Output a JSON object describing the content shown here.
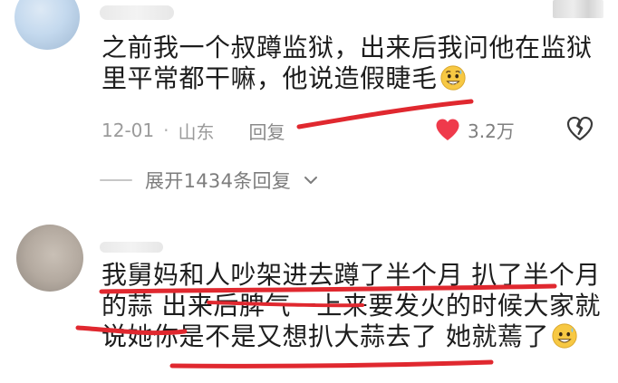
{
  "comments": [
    {
      "text_main": "之前我一个叔蹲监狱，出来后我问他在监狱里平常都干嘛，他说造假睫毛",
      "date": "12-01",
      "separator": "·",
      "location": "山东",
      "reply_label": "回复",
      "like_count": "3.2万",
      "liked": true,
      "emoji": "grinning-sweat-face-emoji"
    },
    {
      "text_main": "我舅妈和人吵架进去蹲了半个月 扒了半个月的蒜 出来后脾气一上来要发火的时候大家就说她你是不是又想扒大蒜去了 她就蔫了",
      "emoji": "grinning-sweat-face-emoji"
    }
  ],
  "expand_replies_label": "展开1434条回复",
  "icons": {
    "like": "heart-icon",
    "dislike": "broken-heart-icon",
    "expand": "chevron-down-icon"
  },
  "colors": {
    "like_red": "#ef3a4b",
    "underline_red": "#e0282f",
    "meta_gray": "#9b9b9b",
    "text_dark": "#1d1d1d"
  }
}
